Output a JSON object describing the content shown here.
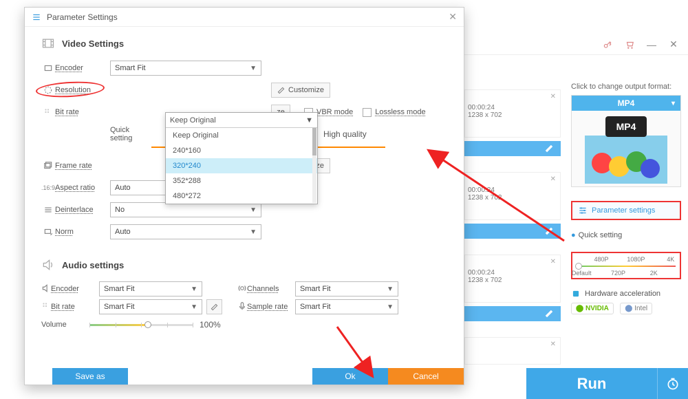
{
  "dialog": {
    "title": "Parameter Settings",
    "video_section": "Video Settings",
    "rows": {
      "encoder": {
        "label": "Encoder",
        "value": "Smart Fit"
      },
      "resolution": {
        "label": "Resolution",
        "value": "Keep Original",
        "options": [
          "Keep Original",
          "240*160",
          "320*240",
          "352*288",
          "480*272"
        ],
        "selected": "320*240"
      },
      "bitrate": {
        "label": "Bit rate",
        "vbr": "VBR mode",
        "lossless": "Lossless mode"
      },
      "quick": "Quick setting",
      "high_quality": "High quality",
      "framerate": {
        "label": "Frame rate"
      },
      "aspect": {
        "label": "Aspect ratio",
        "value": "Auto"
      },
      "deinterlace": {
        "label": "Deinterlace",
        "value": "No"
      },
      "norm": {
        "label": "Norm",
        "value": "Auto"
      }
    },
    "customize": "Customize",
    "audio_section": "Audio settings",
    "audio": {
      "encoder": {
        "label": "Encoder",
        "value": "Smart Fit"
      },
      "bitrate": {
        "label": "Bit rate",
        "value": "Smart Fit"
      },
      "channels": {
        "label": "Channels",
        "value": "Smart Fit"
      },
      "samplerate": {
        "label": "Sample rate",
        "value": "Smart Fit"
      },
      "volume": {
        "label": "Volume",
        "value": "100%"
      }
    },
    "buttons": {
      "save": "Save as",
      "ok": "Ok",
      "cancel": "Cancel"
    }
  },
  "bg": {
    "output_label": "Click to change output format:",
    "format": "MP4",
    "param_btn": "Parameter settings",
    "quick_setting": "Quick setting",
    "ticks_top": [
      "480P",
      "1080P",
      "4K"
    ],
    "ticks_bottom": [
      "Default",
      "720P",
      "2K"
    ],
    "hw": "Hardware acceleration",
    "nvidia": "NVIDIA",
    "intel": "Intel",
    "run": "Run",
    "items": [
      {
        "time": "00:00:24",
        "res": "1238 x 702"
      },
      {
        "time": "00:00:24",
        "res": "1238 x 702"
      },
      {
        "time": "00:00:24",
        "res": "1238 x 702"
      }
    ]
  }
}
